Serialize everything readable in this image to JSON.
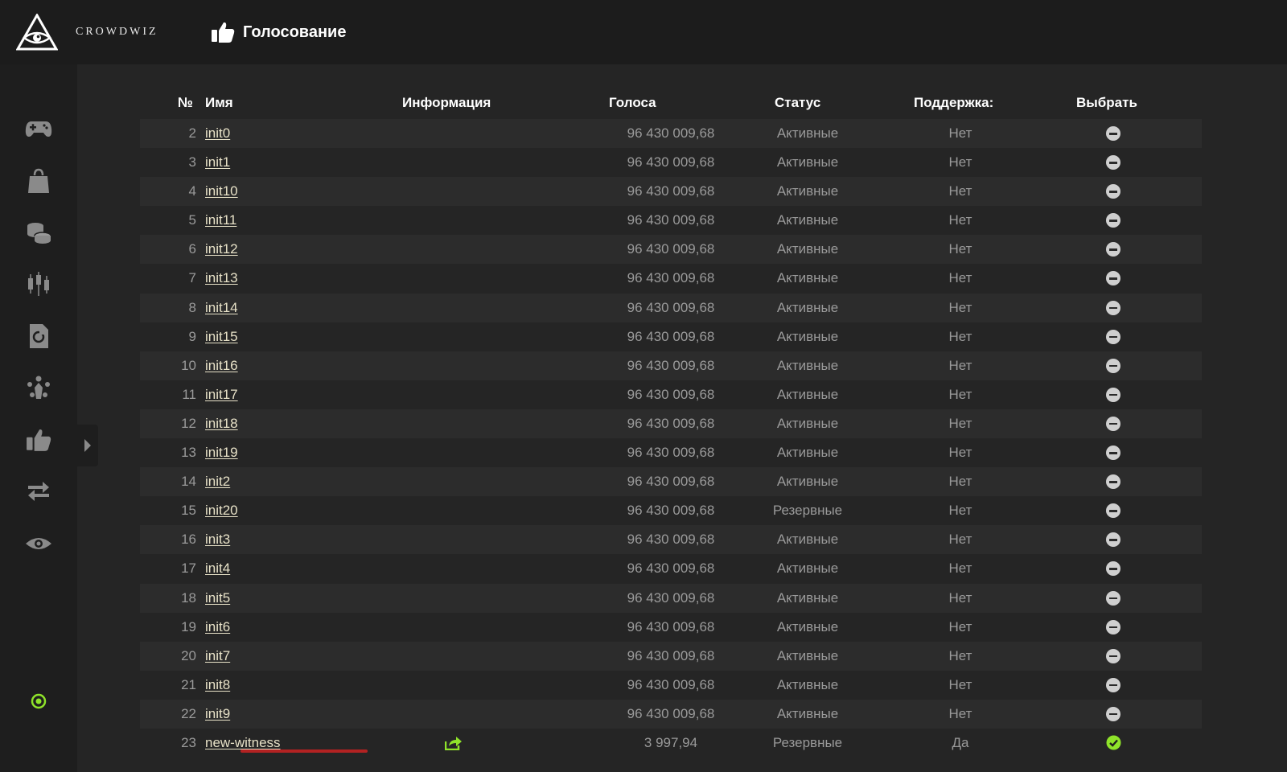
{
  "header": {
    "brand": "CROWDWIZ",
    "page_title": "Голосование"
  },
  "sidebar": {
    "items": [
      "gamepad-icon",
      "shopping-bag-icon",
      "coins-icon",
      "candlestick-chart-icon",
      "document-cycle-icon",
      "network-icon",
      "thumbs-up-icon",
      "exchange-arrows-icon",
      "eye-icon"
    ],
    "status": "online-status-icon"
  },
  "table": {
    "headers": {
      "num": "№",
      "name": "Имя",
      "info": "Информация",
      "votes": "Голоса",
      "status": "Статус",
      "support": "Поддержка:",
      "select": "Выбрать"
    },
    "rows": [
      {
        "num": "2",
        "name": "init0",
        "votes": "96 430 009,68",
        "status": "Активные",
        "support": "Нет",
        "selected": false
      },
      {
        "num": "3",
        "name": "init1",
        "votes": "96 430 009,68",
        "status": "Активные",
        "support": "Нет",
        "selected": false
      },
      {
        "num": "4",
        "name": "init10",
        "votes": "96 430 009,68",
        "status": "Активные",
        "support": "Нет",
        "selected": false
      },
      {
        "num": "5",
        "name": "init11",
        "votes": "96 430 009,68",
        "status": "Активные",
        "support": "Нет",
        "selected": false
      },
      {
        "num": "6",
        "name": "init12",
        "votes": "96 430 009,68",
        "status": "Активные",
        "support": "Нет",
        "selected": false
      },
      {
        "num": "7",
        "name": "init13",
        "votes": "96 430 009,68",
        "status": "Активные",
        "support": "Нет",
        "selected": false
      },
      {
        "num": "8",
        "name": "init14",
        "votes": "96 430 009,68",
        "status": "Активные",
        "support": "Нет",
        "selected": false
      },
      {
        "num": "9",
        "name": "init15",
        "votes": "96 430 009,68",
        "status": "Активные",
        "support": "Нет",
        "selected": false
      },
      {
        "num": "10",
        "name": "init16",
        "votes": "96 430 009,68",
        "status": "Активные",
        "support": "Нет",
        "selected": false
      },
      {
        "num": "11",
        "name": "init17",
        "votes": "96 430 009,68",
        "status": "Активные",
        "support": "Нет",
        "selected": false
      },
      {
        "num": "12",
        "name": "init18",
        "votes": "96 430 009,68",
        "status": "Активные",
        "support": "Нет",
        "selected": false
      },
      {
        "num": "13",
        "name": "init19",
        "votes": "96 430 009,68",
        "status": "Активные",
        "support": "Нет",
        "selected": false
      },
      {
        "num": "14",
        "name": "init2",
        "votes": "96 430 009,68",
        "status": "Активные",
        "support": "Нет",
        "selected": false
      },
      {
        "num": "15",
        "name": "init20",
        "votes": "96 430 009,68",
        "status": "Резервные",
        "support": "Нет",
        "selected": false
      },
      {
        "num": "16",
        "name": "init3",
        "votes": "96 430 009,68",
        "status": "Активные",
        "support": "Нет",
        "selected": false
      },
      {
        "num": "17",
        "name": "init4",
        "votes": "96 430 009,68",
        "status": "Активные",
        "support": "Нет",
        "selected": false
      },
      {
        "num": "18",
        "name": "init5",
        "votes": "96 430 009,68",
        "status": "Активные",
        "support": "Нет",
        "selected": false
      },
      {
        "num": "19",
        "name": "init6",
        "votes": "96 430 009,68",
        "status": "Активные",
        "support": "Нет",
        "selected": false
      },
      {
        "num": "20",
        "name": "init7",
        "votes": "96 430 009,68",
        "status": "Активные",
        "support": "Нет",
        "selected": false
      },
      {
        "num": "21",
        "name": "init8",
        "votes": "96 430 009,68",
        "status": "Активные",
        "support": "Нет",
        "selected": false
      },
      {
        "num": "22",
        "name": "init9",
        "votes": "96 430 009,68",
        "status": "Активные",
        "support": "Нет",
        "selected": false
      },
      {
        "num": "23",
        "name": "new-witness",
        "votes": "3 997,94",
        "status": "Резервные",
        "support": "Да",
        "selected": true,
        "info_icon": "share-icon",
        "highlighted": true
      }
    ]
  },
  "colors": {
    "accent": "#8fe32a",
    "highlight": "#b32222"
  }
}
